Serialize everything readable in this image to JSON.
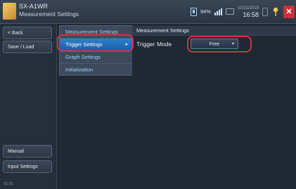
{
  "app": {
    "name": "SX-A1WR",
    "subtitle": "Measurement Settings"
  },
  "status": {
    "battery": "94%",
    "date": "10/22/2019",
    "time": "16:58",
    "close": "✕"
  },
  "sidebar": {
    "back_label": "< Back",
    "save_load_label": "Save / Load",
    "manual_label": "Manual",
    "input_settings_label": "Input Settings",
    "version": "02.01"
  },
  "menu": {
    "items": [
      {
        "label": "Measurement Settings"
      },
      {
        "label": "Trigger Settings",
        "arrow": "▸"
      },
      {
        "label": "Graph Settings"
      },
      {
        "label": "Initialization"
      }
    ]
  },
  "content": {
    "header": "Measurement Settings",
    "trigger_mode_label": "Trigger Mode",
    "trigger_mode_value": "Free",
    "dropdown_arrow": "▾"
  },
  "colors": {
    "accent": "#1c5fa8",
    "highlight": "#d2343e",
    "menu_text": "#8fd2ff"
  }
}
